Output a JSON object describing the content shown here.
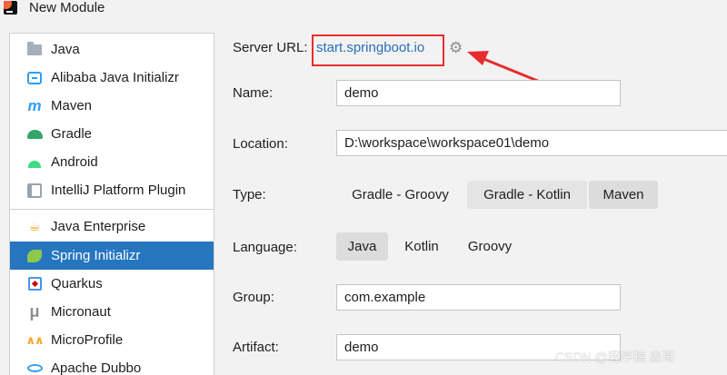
{
  "window": {
    "title": "New Module",
    "app_icon": "intellij-idea-icon"
  },
  "sidebar": {
    "items": [
      {
        "label": "Java",
        "icon": "folder-icon"
      },
      {
        "label": "Alibaba Java Initializr",
        "icon": "alibaba-icon"
      },
      {
        "label": "Maven",
        "icon": "maven-icon"
      },
      {
        "label": "Gradle",
        "icon": "gradle-icon"
      },
      {
        "label": "Android",
        "icon": "android-icon"
      },
      {
        "label": "IntelliJ Platform Plugin",
        "icon": "plugin-icon"
      },
      {
        "label": "Java Enterprise",
        "icon": "java-enterprise-icon"
      },
      {
        "label": "Spring Initializr",
        "icon": "spring-icon",
        "selected": true
      },
      {
        "label": "Quarkus",
        "icon": "quarkus-icon"
      },
      {
        "label": "Micronaut",
        "icon": "micronaut-icon"
      },
      {
        "label": "MicroProfile",
        "icon": "microprofile-icon"
      },
      {
        "label": "Apache Dubbo",
        "icon": "dubbo-icon"
      }
    ],
    "selected_color": "#2675bf"
  },
  "form": {
    "server_url": {
      "label": "Server URL:",
      "value": "start.springboot.io",
      "link_color": "#2770b8"
    },
    "name": {
      "label": "Name:",
      "value": "demo"
    },
    "location": {
      "label": "Location:",
      "value": "D:\\workspace\\workspace01\\demo"
    },
    "type": {
      "label": "Type:",
      "options": [
        "Gradle - Groovy",
        "Gradle - Kotlin",
        "Maven"
      ],
      "selected": "Maven"
    },
    "language": {
      "label": "Language:",
      "options": [
        "Java",
        "Kotlin",
        "Groovy"
      ],
      "selected": "Java"
    },
    "group": {
      "label": "Group:",
      "value": "com.example"
    },
    "artifact": {
      "label": "Artifact:",
      "value": "demo"
    }
  },
  "annotation": {
    "color": "#e62d2d"
  },
  "watermark": "CSDN @程序猿 淼哥"
}
